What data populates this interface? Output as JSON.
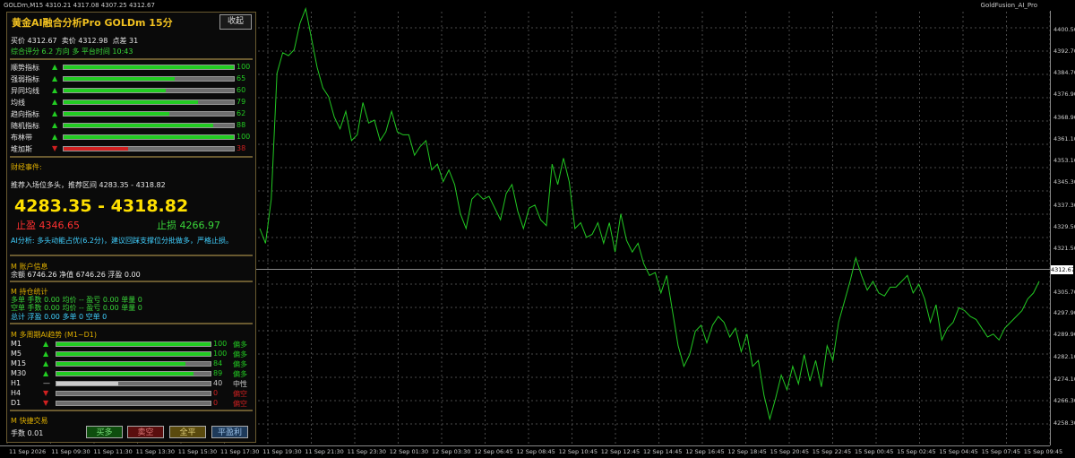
{
  "window": {
    "symbol_line": "GOLDm,M15  4310.21 4317.08 4307.25 4312.67",
    "title": "GoldFusion_AI_Pro"
  },
  "chart": {
    "type": "line",
    "color": "#22c822",
    "grid_color": "#4a4a4a",
    "current_price": "4312.67",
    "y_ticks": [
      "4400.50",
      "4392.70",
      "4384.70",
      "4376.90",
      "4368.90",
      "4361.10",
      "4353.10",
      "4345.30",
      "4337.30",
      "4329.50",
      "4321.50",
      "4305.70",
      "4297.90",
      "4289.90",
      "4282.10",
      "4274.10",
      "4266.30",
      "4258.30"
    ],
    "x_ticks": [
      "11 Sep 2026",
      "11 Sep 09:30",
      "11 Sep 11:30",
      "11 Sep 13:30",
      "11 Sep 15:30",
      "11 Sep 17:30",
      "11 Sep 19:30",
      "11 Sep 21:30",
      "11 Sep 23:30",
      "12 Sep 01:30",
      "12 Sep 03:30",
      "12 Sep 06:45",
      "12 Sep 08:45",
      "12 Sep 10:45",
      "12 Sep 12:45",
      "12 Sep 14:45",
      "12 Sep 16:45",
      "12 Sep 18:45",
      "15 Sep 20:45",
      "15 Sep 22:45",
      "15 Sep 00:45",
      "15 Sep 02:45",
      "15 Sep 04:45",
      "15 Sep 07:45",
      "15 Sep 09:45"
    ]
  },
  "chart_data": {
    "type": "line",
    "ylim": [
      4256,
      4404
    ],
    "series": [
      {
        "values": [
          4330,
          4325,
          4340,
          4383,
          4390,
          4389,
          4391,
          4400,
          4405,
          4395,
          4385,
          4378,
          4375,
          4368,
          4364,
          4370,
          4360,
          4362,
          4373,
          4366,
          4367,
          4360,
          4363,
          4370,
          4363,
          4362,
          4362,
          4355,
          4358,
          4360,
          4350,
          4352,
          4346,
          4350,
          4345,
          4335,
          4330,
          4340,
          4342,
          4340,
          4341,
          4337,
          4333,
          4342,
          4345,
          4336,
          4330,
          4337,
          4338,
          4333,
          4331,
          4352,
          4345,
          4354,
          4346,
          4330,
          4332,
          4327,
          4328,
          4332,
          4325,
          4332,
          4322,
          4335,
          4326,
          4322,
          4325,
          4318,
          4314,
          4315,
          4308,
          4314,
          4302,
          4290,
          4283,
          4287,
          4295,
          4297,
          4291,
          4297,
          4300,
          4298,
          4293,
          4296,
          4288,
          4294,
          4283,
          4285,
          4273,
          4265,
          4272,
          4280,
          4275,
          4283,
          4277,
          4287,
          4278,
          4285,
          4276,
          4290,
          4285,
          4298,
          4305,
          4312,
          4320,
          4314,
          4309,
          4312,
          4308,
          4307,
          4310,
          4310,
          4312,
          4314,
          4308,
          4311,
          4306,
          4298,
          4304,
          4292,
          4296,
          4298,
          4303,
          4302,
          4300,
          4299,
          4296,
          4293,
          4294,
          4292,
          4296,
          4298,
          4300,
          4302,
          4306,
          4308,
          4312
        ]
      }
    ]
  },
  "panel": {
    "title": "黄金AI融合分析Pro  GOLDm 15分",
    "collapse_label": "收起",
    "quote": {
      "bid_label": "买价",
      "bid": "4312.67",
      "ask_label": "卖价",
      "ask": "4312.98",
      "spread_label": "点差",
      "spread": "31"
    },
    "score_line": "综合评分 6.2  方向 多  平台时间 10:43",
    "indicators": [
      {
        "name": "顺势指标",
        "arrow": "▲",
        "value": "100",
        "fill": 1.0,
        "color": "#22cc22"
      },
      {
        "name": "强弱指标",
        "arrow": "▲",
        "value": "65",
        "fill": 0.65,
        "color": "#22cc22"
      },
      {
        "name": "异同均线",
        "arrow": "▲",
        "value": "60",
        "fill": 0.6,
        "color": "#22cc22"
      },
      {
        "name": "均线",
        "arrow": "▲",
        "value": "79",
        "fill": 0.79,
        "color": "#22cc22"
      },
      {
        "name": "趋向指标",
        "arrow": "▲",
        "value": "62",
        "fill": 0.62,
        "color": "#22cc22"
      },
      {
        "name": "随机指标",
        "arrow": "▲",
        "value": "88",
        "fill": 0.88,
        "color": "#22cc22"
      },
      {
        "name": "布林带",
        "arrow": "▲",
        "value": "100",
        "fill": 1.0,
        "color": "#22cc22"
      },
      {
        "name": "堆加斯",
        "arrow": "▼",
        "value": "38",
        "fill": 0.38,
        "color": "#d02020"
      }
    ],
    "news_title": "财经事件:",
    "recommend_line": "推荐入场位多头，推荐区间 4283.35 - 4318.82",
    "range": "4283.35 - 4318.82",
    "tp_label": "止盈",
    "tp": "4346.65",
    "sl_label": "止损",
    "sl": "4266.97",
    "ai_analysis": "AI分析: 多头动能占优(6.2分)，建议回踩支撑位分批做多，严格止损。",
    "account": {
      "title": "M 账户信息",
      "line": "余额 6746.26  净值 6746.26  浮盈 0.00"
    },
    "positions": {
      "title": "M 持仓统计",
      "long": "多单  手数 0.00  均价 --  盈亏 0.00  单量 0",
      "short": "空单  手数 0.00  均价 --  盈亏 0.00  单量 0",
      "total": "总计  浮盈 0.00  多单 0  空单 0"
    },
    "timeframes": {
      "title": "M 多周期AI趋势 (M1~D1)",
      "rows": [
        {
          "tf": "M1",
          "arrow": "▲",
          "value": "100",
          "fill": 1.0,
          "color": "#22cc22",
          "label": "偏多"
        },
        {
          "tf": "M5",
          "arrow": "▲",
          "value": "100",
          "fill": 1.0,
          "color": "#22cc22",
          "label": "偏多"
        },
        {
          "tf": "M15",
          "arrow": "▲",
          "value": "84",
          "fill": 0.84,
          "color": "#22cc22",
          "label": "偏多"
        },
        {
          "tf": "M30",
          "arrow": "▲",
          "value": "89",
          "fill": 0.89,
          "color": "#22cc22",
          "label": "偏多"
        },
        {
          "tf": "H1",
          "arrow": "—",
          "value": "40",
          "fill": 0.4,
          "color": "#cccccc",
          "label": "中性"
        },
        {
          "tf": "H4",
          "arrow": "▼",
          "value": "0",
          "fill": 0.0,
          "color": "#d02020",
          "label": "偏空"
        },
        {
          "tf": "D1",
          "arrow": "▼",
          "value": "0",
          "fill": 0.0,
          "color": "#d02020",
          "label": "偏空"
        }
      ]
    },
    "quick_trade": {
      "title": "M 快捷交易",
      "lots": "手数 0.01",
      "buttons": [
        "买多",
        "卖空",
        "全平",
        "平盈利"
      ]
    }
  }
}
